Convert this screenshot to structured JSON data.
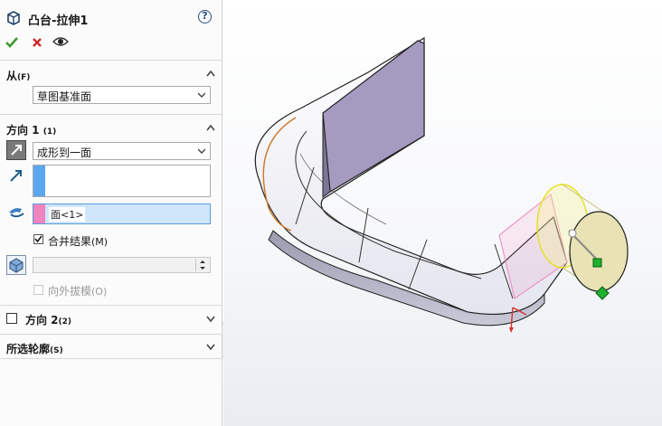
{
  "panel": {
    "title": "凸台-拉伸1",
    "help_label": "?",
    "from": {
      "title": "从",
      "shortcut": "(F)",
      "start_condition": "草图基准面"
    },
    "direction1": {
      "title": "方向 1",
      "shortcut": "(1)",
      "end_condition": "成形到一面",
      "face_selection": "面<1>",
      "merge_label": "合并结果",
      "merge_shortcut": "(M)",
      "draft_label": "向外拔模",
      "draft_shortcut": "(O)"
    },
    "direction2": {
      "title": "方向 2",
      "shortcut": "(2)"
    },
    "contours": {
      "title": "所选轮廓",
      "shortcut": "(S)"
    }
  },
  "colors": {
    "accept_green": "#3a9a2f",
    "cancel_red": "#cc2b2b",
    "direction_blue": "#5ba7ef",
    "selection_pink": "#ef85bd",
    "selection_field_bg": "#cfe6fb",
    "model_body": "#f2f2f6",
    "model_wall": "#a59ac0",
    "preview_yellow": "#e8e2b4"
  },
  "icons": [
    "part-icon",
    "help-icon",
    "accept-icon",
    "cancel-icon",
    "eye-icon",
    "reverse-direction-icon",
    "direction-vector-icon",
    "face-select-icon",
    "depth-icon"
  ]
}
